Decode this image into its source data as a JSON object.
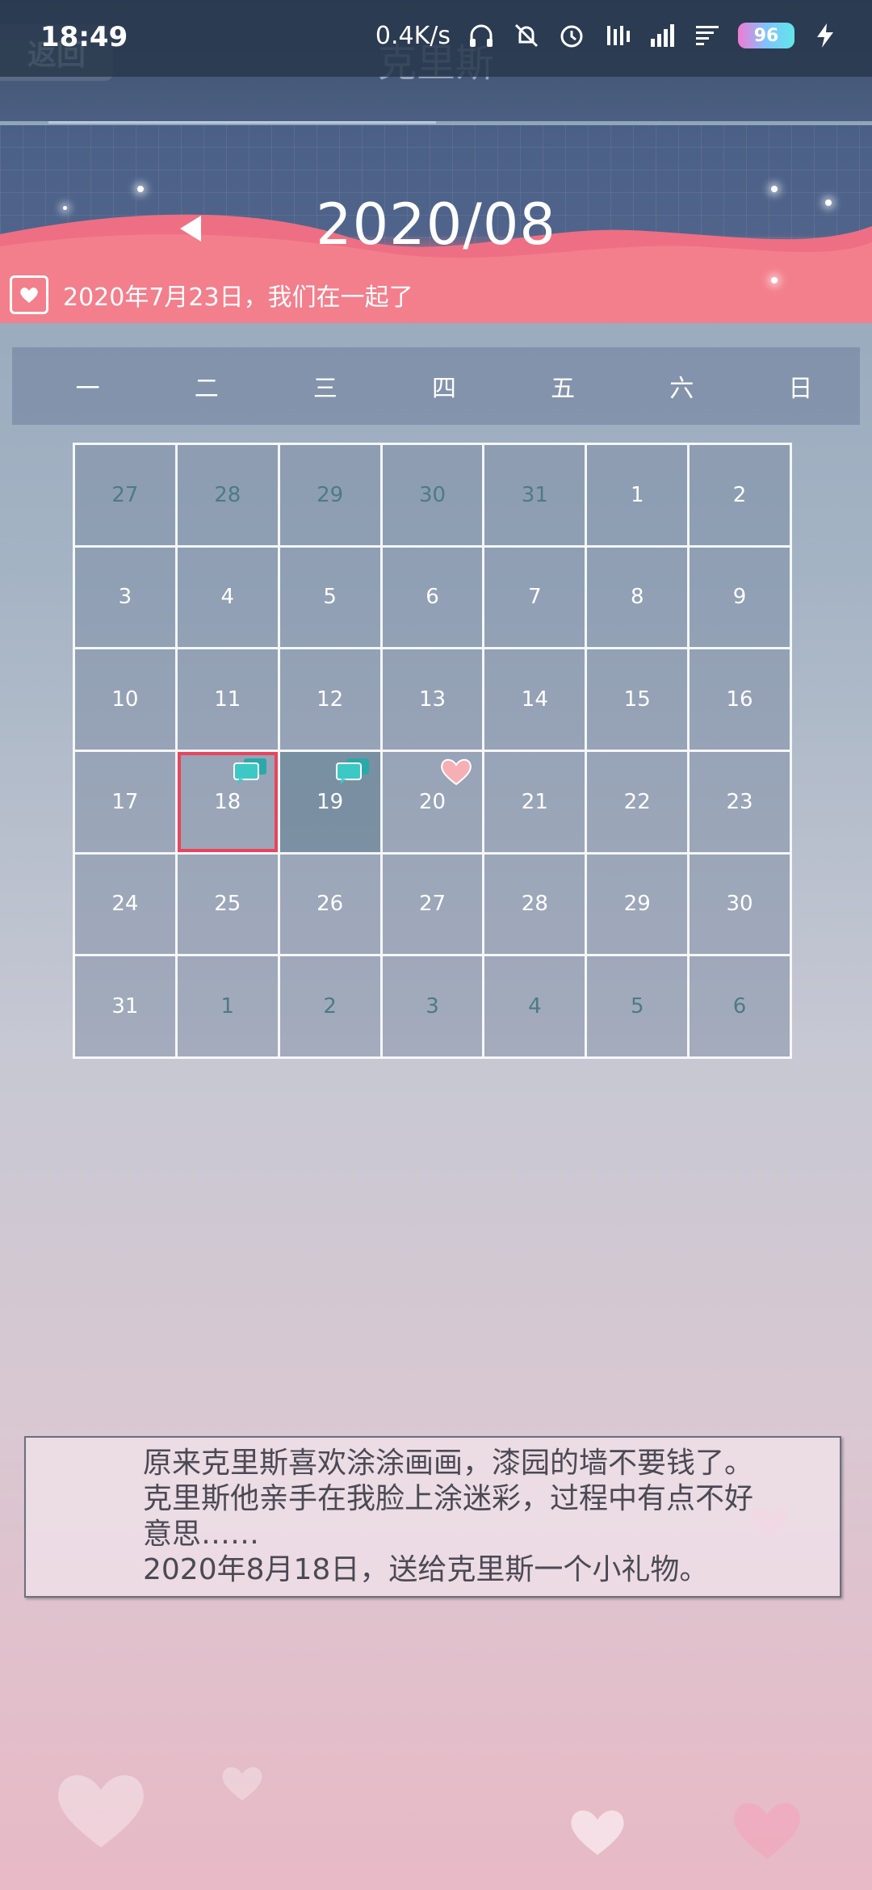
{
  "status": {
    "time": "18:49",
    "net_speed": "0.4K/s",
    "battery": "96"
  },
  "header": {
    "back_label": "返回",
    "title": "克里斯"
  },
  "banner": {
    "month": "2020/08",
    "anniversary": "2020年7月23日，我们在一起了"
  },
  "weekdays": [
    "一",
    "二",
    "三",
    "四",
    "五",
    "六",
    "日"
  ],
  "calendar": {
    "rows": [
      [
        "27",
        "28",
        "29",
        "30",
        "31",
        "1",
        "2"
      ],
      [
        "3",
        "4",
        "5",
        "6",
        "7",
        "8",
        "9"
      ],
      [
        "10",
        "11",
        "12",
        "13",
        "14",
        "15",
        "16"
      ],
      [
        "17",
        "18",
        "19",
        "20",
        "21",
        "22",
        "23"
      ],
      [
        "24",
        "25",
        "26",
        "27",
        "28",
        "29",
        "30"
      ],
      [
        "31",
        "1",
        "2",
        "3",
        "4",
        "5",
        "6"
      ]
    ]
  },
  "diary": {
    "text": "原来克里斯喜欢涂涂画画，漆园的墙不要钱了。克里斯他亲手在我脸上涂迷彩，过程中有点不好意思……\n2020年8月18日，送给克里斯一个小礼物。"
  },
  "colors": {
    "selected_border": "#e8445c",
    "chat_badge": "#2fbfbf",
    "heart_badge": "#f4a0a8"
  }
}
